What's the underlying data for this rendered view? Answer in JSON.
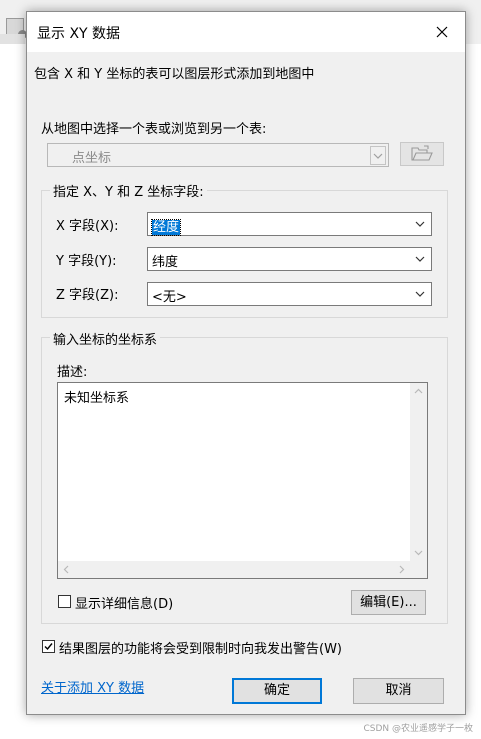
{
  "dialog": {
    "title": "显示 XY 数据",
    "description": "包含 X 和 Y 坐标的表可以图层形式添加到地图中",
    "choose_table_label": "从地图中选择一个表或浏览到另一个表:",
    "table_combo_value": "点坐标"
  },
  "fields_group": {
    "label": "指定 X、Y 和 Z 坐标字段:",
    "x_label": "X 字段(X):",
    "x_value": "经度",
    "y_label": "Y 字段(Y):",
    "y_value": "纬度",
    "z_label": "Z 字段(Z):",
    "z_value": "<无>"
  },
  "coord_group": {
    "label": "输入坐标的坐标系",
    "desc_label": "描述:",
    "desc_text": "未知坐标系",
    "show_details_label": "显示详细信息(D)",
    "show_details_checked": false,
    "edit_button": "编辑(E)..."
  },
  "warning_checkbox": {
    "label": "结果图层的功能将会受到限制时向我发出警告(W)",
    "checked": true
  },
  "footer": {
    "about_link": "关于添加 XY 数据",
    "ok_button": "确定",
    "cancel_button": "取消"
  },
  "watermark": "CSDN @农业遥感学子一枚",
  "colors": {
    "accent": "#0078d7",
    "link": "#0066cc",
    "dialog_bg": "#f0f0f0"
  },
  "icons": [
    "close-icon",
    "chevron-down-icon",
    "folder-open-icon",
    "checkmark-icon",
    "scroll-arrow-icon",
    "app-window-icon"
  ]
}
